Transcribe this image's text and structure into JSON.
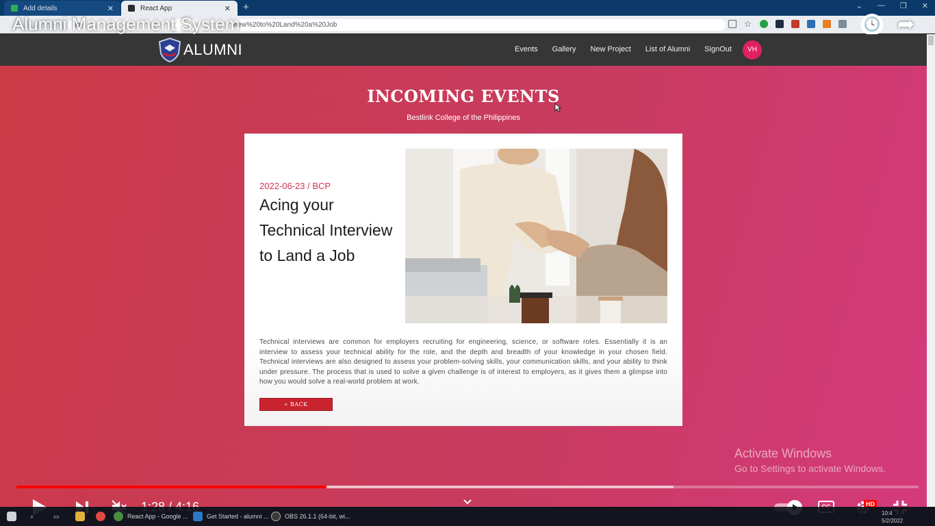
{
  "browser": {
    "tabs": [
      {
        "label": "Add details",
        "active": false
      },
      {
        "label": "React App",
        "active": true
      }
    ],
    "new_tab": "+",
    "url_start": "lo",
    "url_end": "view%20to%20Land%20a%20Job"
  },
  "video": {
    "title": "Alumni Management System",
    "time": "1:28 / 4:16",
    "progress_fraction": 0.344,
    "buffered_fraction": 0.728,
    "quality_badge": "HD",
    "cc_label": "CC"
  },
  "app": {
    "brand": "ALUMNI",
    "nav": [
      "Events",
      "Gallery",
      "New Project",
      "List of Alumni",
      "SignOut"
    ],
    "avatar_initials": "VH",
    "colors": {
      "navbar": "#363636",
      "background_left": "#cc3a47",
      "background_right": "#d43a7a",
      "accent": "#c9232e",
      "avatar": "#e0215f"
    }
  },
  "page": {
    "heading": "INCOMING EVENTS",
    "subheading": "Bestlink College of the Philippines"
  },
  "event": {
    "meta": "2022-06-23 / BCP",
    "title": "Acing your Technical Interview to Land a Job",
    "description": "Technical interviews are common for employers recruiting for engineering, science, or software roles. Essentially it is an interview to assess your technical ability for the role, and the depth and breadth of your knowledge in your chosen field. Technical interviews are also designed to assess your problem-solving skills, your communication skills, and your ability to think under pressure. The process that is used to solve a given challenge is of interest to employers, as it gives them a glimpse into how you would solve a real-world problem at work.",
    "back_label": "« BACK"
  },
  "watermark": {
    "line1": "Activate Windows",
    "line2": "Go to Settings to activate Windows."
  },
  "taskbar": {
    "items": [
      "React App - Google ...",
      "Get Started - alumni ...",
      "OBS 26.1.1 (64-bit, wi..."
    ],
    "time": "10:4",
    "date": "5/2/2022"
  }
}
